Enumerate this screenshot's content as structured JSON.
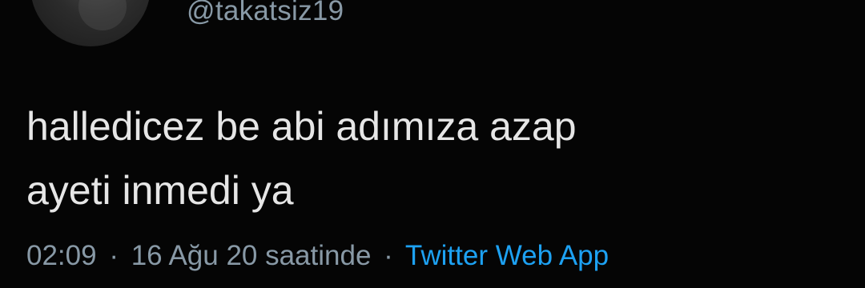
{
  "tweet": {
    "handle": "@takatsiz19",
    "text_line1": "halledicez be abi adımıza azap",
    "text_line2": "ayeti inmedi ya",
    "time": "02:09",
    "separator": "·",
    "date": "16 Ağu 20 saatinde",
    "source": "Twitter Web App"
  },
  "colors": {
    "background": "#050505",
    "text": "#e6e6e6",
    "secondary": "#8899a6",
    "link": "#1da1f2"
  },
  "icons": {
    "avatar": "profile-photo"
  }
}
